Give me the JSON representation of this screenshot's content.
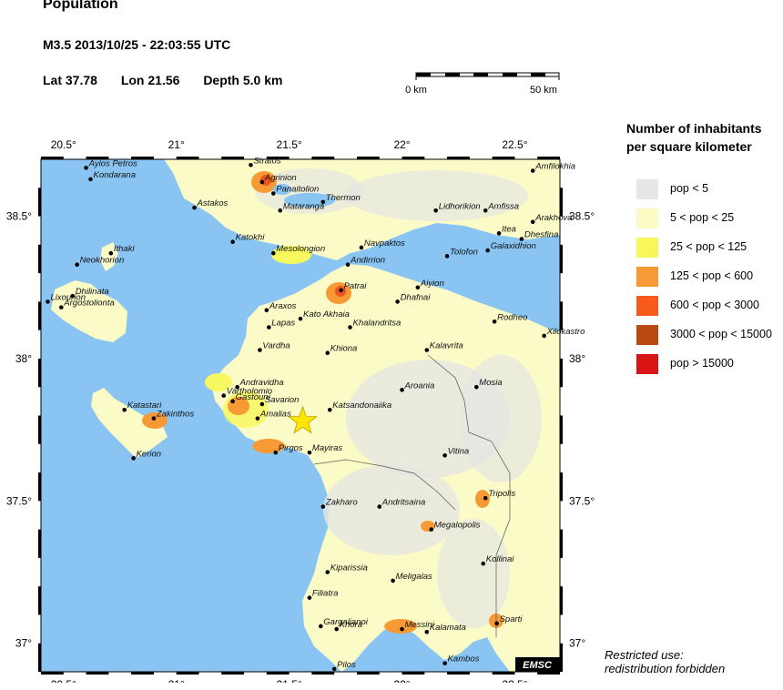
{
  "header": {
    "title": "Population",
    "event": "M3.5  2013/10/25 - 22:03:55 UTC",
    "lat": "Lat 37.78",
    "lon": "Lon  21.56",
    "depth": "Depth  5.0 km"
  },
  "scale": {
    "left_label": "0 km",
    "right_label": "50 km"
  },
  "map": {
    "lon_range": [
      20.4,
      22.7
    ],
    "lat_range": [
      36.9,
      38.7
    ],
    "lon_ticks": [
      "20.5°",
      "21°",
      "21.5°",
      "22°",
      "22.5°"
    ],
    "lon_tick_values": [
      20.5,
      21.0,
      21.5,
      22.0,
      22.5
    ],
    "lat_ticks": [
      "38.5°",
      "38°",
      "37.5°",
      "37°"
    ],
    "lat_tick_values": [
      38.5,
      38.0,
      37.5,
      37.0
    ],
    "colors": {
      "sea": "#8ac4f2",
      "land": "#e6e6e2",
      "low": "#fbfbc8",
      "mid": "#f7f760",
      "high": "#f79a36",
      "urban": "#e8551d"
    },
    "epicenter": {
      "lat": 37.78,
      "lon": 21.56
    },
    "cities": [
      {
        "name": "Ayios Petros",
        "lon": 20.6,
        "lat": 38.67
      },
      {
        "name": "Kondarana",
        "lon": 20.62,
        "lat": 38.63
      },
      {
        "name": "Stratos",
        "lon": 21.33,
        "lat": 38.68
      },
      {
        "name": "Amfilokhia",
        "lon": 22.58,
        "lat": 38.66
      },
      {
        "name": "Agrinion",
        "lon": 21.38,
        "lat": 38.62
      },
      {
        "name": "Panaitolion",
        "lon": 21.43,
        "lat": 38.58
      },
      {
        "name": "Thermon",
        "lon": 21.65,
        "lat": 38.55
      },
      {
        "name": "Astakos",
        "lon": 21.08,
        "lat": 38.53
      },
      {
        "name": "Mataranga",
        "lon": 21.46,
        "lat": 38.52
      },
      {
        "name": "Lidhorikion",
        "lon": 22.15,
        "lat": 38.52
      },
      {
        "name": "Amfissa",
        "lon": 22.37,
        "lat": 38.52
      },
      {
        "name": "Itea",
        "lon": 22.43,
        "lat": 38.44
      },
      {
        "name": "Arakhova",
        "lon": 22.58,
        "lat": 38.48
      },
      {
        "name": "Dhesfina",
        "lon": 22.53,
        "lat": 38.42
      },
      {
        "name": "Katokhi",
        "lon": 21.25,
        "lat": 38.41
      },
      {
        "name": "Mesolongion",
        "lon": 21.43,
        "lat": 38.37
      },
      {
        "name": "Navpaktos",
        "lon": 21.82,
        "lat": 38.39
      },
      {
        "name": "Galaxidhion",
        "lon": 22.38,
        "lat": 38.38
      },
      {
        "name": "Tolofon",
        "lon": 22.2,
        "lat": 38.36
      },
      {
        "name": "Ithaki",
        "lon": 20.71,
        "lat": 38.37
      },
      {
        "name": "Neokhorion",
        "lon": 20.56,
        "lat": 38.33
      },
      {
        "name": "Andirrion",
        "lon": 21.76,
        "lat": 38.33
      },
      {
        "name": "Aiyion",
        "lon": 22.07,
        "lat": 38.25
      },
      {
        "name": "Patrai",
        "lon": 21.73,
        "lat": 38.24
      },
      {
        "name": "Dhilinata",
        "lon": 20.54,
        "lat": 38.22
      },
      {
        "name": "Lixourion",
        "lon": 20.43,
        "lat": 38.2
      },
      {
        "name": "Argostolionta",
        "lon": 20.49,
        "lat": 38.18
      },
      {
        "name": "Dhafnai",
        "lon": 21.98,
        "lat": 38.2
      },
      {
        "name": "Araxos",
        "lon": 21.4,
        "lat": 38.17
      },
      {
        "name": "Kato Akhaia",
        "lon": 21.55,
        "lat": 38.14
      },
      {
        "name": "Rodheo",
        "lon": 22.41,
        "lat": 38.13
      },
      {
        "name": "Lapas",
        "lon": 21.41,
        "lat": 38.11
      },
      {
        "name": "Khalandritsa",
        "lon": 21.77,
        "lat": 38.11
      },
      {
        "name": "Xilokastro",
        "lon": 22.63,
        "lat": 38.08
      },
      {
        "name": "Vardha",
        "lon": 21.37,
        "lat": 38.03
      },
      {
        "name": "Khiona",
        "lon": 21.67,
        "lat": 38.02
      },
      {
        "name": "Kalavrita",
        "lon": 22.11,
        "lat": 38.03
      },
      {
        "name": "Andravidha",
        "lon": 21.27,
        "lat": 37.9
      },
      {
        "name": "Vartholomio",
        "lon": 21.21,
        "lat": 37.87
      },
      {
        "name": "Gastouni",
        "lon": 21.25,
        "lat": 37.85
      },
      {
        "name": "Savarion",
        "lon": 21.38,
        "lat": 37.84
      },
      {
        "name": "Aroania",
        "lon": 22.0,
        "lat": 37.89
      },
      {
        "name": "Mosia",
        "lon": 22.33,
        "lat": 37.9
      },
      {
        "name": "Katastari",
        "lon": 20.77,
        "lat": 37.82
      },
      {
        "name": "Zakinthos",
        "lon": 20.9,
        "lat": 37.79
      },
      {
        "name": "Katsandonaiika",
        "lon": 21.68,
        "lat": 37.82
      },
      {
        "name": "Amalias",
        "lon": 21.36,
        "lat": 37.79
      },
      {
        "name": "Pirgos",
        "lon": 21.44,
        "lat": 37.67
      },
      {
        "name": "Mayiras",
        "lon": 21.59,
        "lat": 37.67
      },
      {
        "name": "Vitina",
        "lon": 22.19,
        "lat": 37.66
      },
      {
        "name": "Kerion",
        "lon": 20.81,
        "lat": 37.65
      },
      {
        "name": "Tripolis",
        "lon": 22.37,
        "lat": 37.51
      },
      {
        "name": "Zakharo",
        "lon": 21.65,
        "lat": 37.48
      },
      {
        "name": "Andritsaina",
        "lon": 21.9,
        "lat": 37.48
      },
      {
        "name": "Megalopolis",
        "lon": 22.13,
        "lat": 37.4
      },
      {
        "name": "Kollinai",
        "lon": 22.36,
        "lat": 37.28
      },
      {
        "name": "Kiparissia",
        "lon": 21.67,
        "lat": 37.25
      },
      {
        "name": "Meligalas",
        "lon": 21.96,
        "lat": 37.22
      },
      {
        "name": "Filiatra",
        "lon": 21.59,
        "lat": 37.16
      },
      {
        "name": "Gargalianoi",
        "lon": 21.64,
        "lat": 37.06
      },
      {
        "name": "Khora",
        "lon": 21.71,
        "lat": 37.05
      },
      {
        "name": "Messini",
        "lon": 22.0,
        "lat": 37.05
      },
      {
        "name": "Kalamata",
        "lon": 22.11,
        "lat": 37.04
      },
      {
        "name": "Sparti",
        "lon": 22.42,
        "lat": 37.07
      },
      {
        "name": "Kambos",
        "lon": 22.19,
        "lat": 36.93
      },
      {
        "name": "Pilos",
        "lon": 21.7,
        "lat": 36.91
      }
    ]
  },
  "badge": "EMSC",
  "legend": {
    "title_line1": "Number of inhabitants",
    "title_line2": "per square kilometer",
    "items": [
      {
        "label": "pop < 5",
        "color": "#e6e6e4"
      },
      {
        "label": "5 < pop < 25",
        "color": "#fbfbc6"
      },
      {
        "label": "25 < pop < 125",
        "color": "#f7f75a"
      },
      {
        "label": "125 < pop < 600",
        "color": "#f79a36"
      },
      {
        "label": "600 < pop < 3000",
        "color": "#f85a1c"
      },
      {
        "label": "3000 < pop < 15000",
        "color": "#b84a12"
      },
      {
        "label": "pop > 15000",
        "color": "#d81414"
      }
    ]
  },
  "notice": {
    "line1": "Restricted use:",
    "line2": "redistribution forbidden"
  }
}
